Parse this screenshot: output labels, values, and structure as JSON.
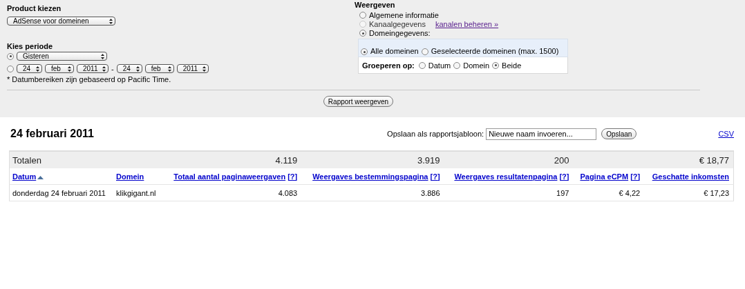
{
  "product": {
    "label": "Product kiezen",
    "value": "AdSense voor domeinen"
  },
  "period": {
    "label": "Kies periode",
    "options": [
      {
        "kind": "preset",
        "selected": true,
        "value": "Gisteren"
      },
      {
        "kind": "range",
        "selected": false,
        "from": [
          "24",
          "feb",
          "2011"
        ],
        "separator": "-",
        "to": [
          "24",
          "feb",
          "2011"
        ]
      }
    ],
    "note": "* Datumbereiken zijn gebaseerd op Pacific Time."
  },
  "view": {
    "label": "Weergeven",
    "options": [
      {
        "label": "Algemene informatie",
        "selected": false,
        "disabled": false
      },
      {
        "label": "Kanaalgegevens",
        "selected": false,
        "disabled": true,
        "link": "kanalen beheren »"
      },
      {
        "label": "Domeingegevens:",
        "selected": true,
        "disabled": false
      }
    ],
    "domains": [
      {
        "label": "Alle domeinen",
        "selected": true
      },
      {
        "label": "Geselecteerde domeinen (max. 1500)",
        "selected": false
      }
    ],
    "group_label": "Groeperen op:",
    "group_options": [
      {
        "label": "Datum",
        "selected": false
      },
      {
        "label": "Domein",
        "selected": false
      },
      {
        "label": "Beide",
        "selected": true
      }
    ]
  },
  "submit": "Rapport weergeven",
  "report": {
    "title": "24 februari 2011",
    "save_label": "Opslaan als rapportsjabloon:",
    "save_value": "Nieuwe naam invoeren...",
    "save_button": "Opslaan",
    "csv": "CSV"
  },
  "table": {
    "totals_label": "Totalen",
    "columns": [
      {
        "label": "Datum",
        "sorted": true
      },
      {
        "label": "Domein",
        "sorted": false
      },
      {
        "label": "Totaal aantal paginaweergaven",
        "help": "[?]",
        "total": "4.119",
        "sorted": false
      },
      {
        "label": "Weergaves bestemmingspagina",
        "help": "[?]",
        "total": "3.919",
        "sorted": false
      },
      {
        "label": "Weergaves resultatenpagina",
        "help": "[?]",
        "total": "200",
        "sorted": false
      },
      {
        "label": "Pagina eCPM",
        "help": "[?]",
        "sorted": false
      },
      {
        "label": "Geschatte inkomsten",
        "total": "€ 18,77",
        "sorted": false
      }
    ],
    "rows": [
      [
        "donderdag 24 februari 2011",
        "klikgigant.nl",
        "4.083",
        "3.886",
        "197",
        "€ 4,22",
        "€ 17,23"
      ]
    ]
  }
}
